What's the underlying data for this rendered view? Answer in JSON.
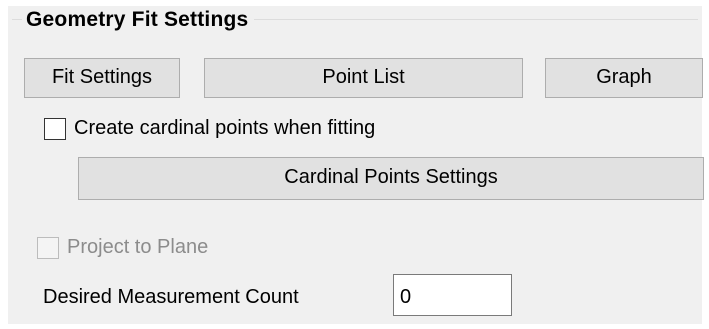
{
  "group": {
    "title": "Geometry Fit Settings"
  },
  "buttons": {
    "fit_settings": "Fit Settings",
    "point_list": "Point List",
    "graph": "Graph",
    "cardinal_points_settings": "Cardinal Points Settings"
  },
  "options": {
    "create_cardinal_points": {
      "label": "Create cardinal points when fitting",
      "checked": false,
      "enabled": true
    },
    "project_to_plane": {
      "label": "Project to Plane",
      "checked": false,
      "enabled": false
    }
  },
  "measurement": {
    "label": "Desired Measurement Count",
    "value": "0"
  },
  "colors": {
    "panel_background": "#f0f0f0",
    "button_face": "#e1e1e1",
    "button_border": "#adadad",
    "disabled_text": "#8c8c8c"
  }
}
